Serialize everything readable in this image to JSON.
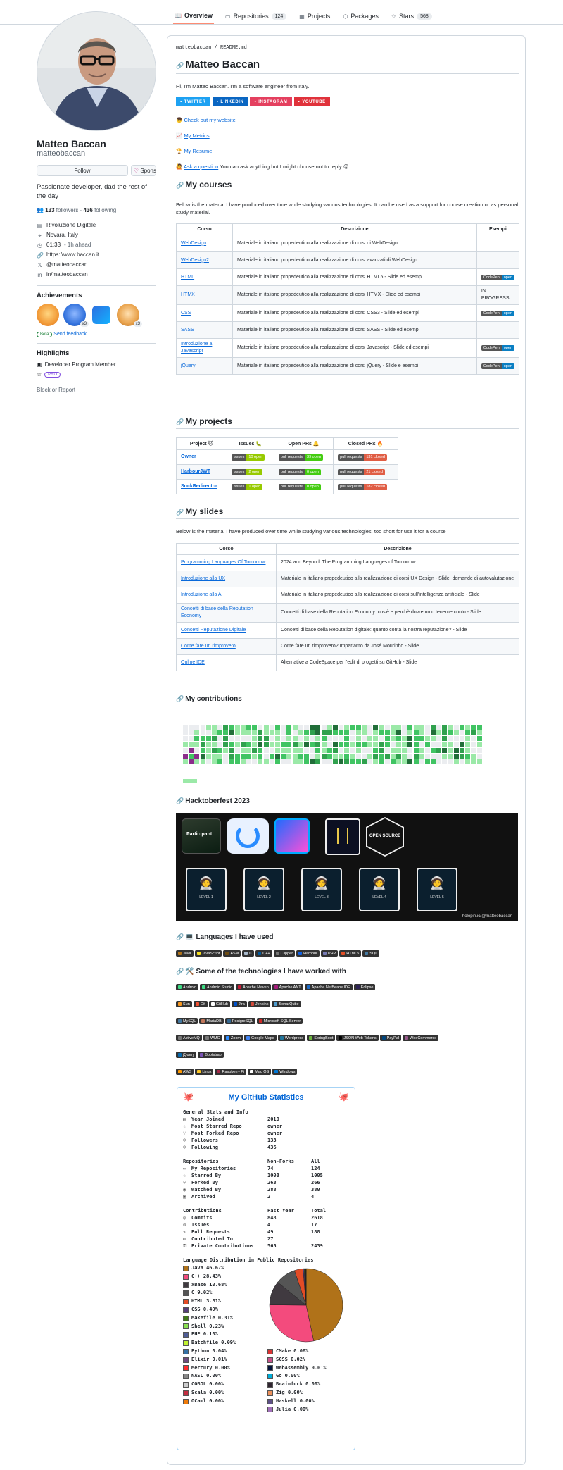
{
  "tabs": [
    {
      "label": "Overview",
      "icon": "book-icon",
      "count": ""
    },
    {
      "label": "Repositories",
      "icon": "repo-icon",
      "count": "124"
    },
    {
      "label": "Projects",
      "icon": "table-icon",
      "count": ""
    },
    {
      "label": "Packages",
      "icon": "package-icon",
      "count": ""
    },
    {
      "label": "Stars",
      "icon": "star-icon",
      "count": "568"
    }
  ],
  "profile": {
    "fullname": "Matteo Baccan",
    "username": "matteobaccan",
    "follow_label": "Follow",
    "sponsor_label": "Sponsor",
    "bio": "Passionate developer, dad the rest of the day",
    "followers": "133",
    "followers_label": "followers",
    "following": "436",
    "following_label": "following",
    "vcard": [
      {
        "icon": "organization-icon",
        "text": "Rivoluzione Digitale"
      },
      {
        "icon": "location-icon",
        "text": "Novara, Italy"
      },
      {
        "icon": "clock-icon",
        "text": "01:33",
        "sub": "- 1h ahead"
      },
      {
        "icon": "link-icon",
        "text": "https://www.baccan.it"
      },
      {
        "icon": "twitter-icon",
        "text": "@matteobaccan"
      },
      {
        "icon": "linkedin-icon",
        "text": "in/matteobaccan"
      }
    ],
    "achievements_title": "Achievements",
    "beta": "Beta",
    "send_feedback": "Send feedback",
    "highlights_title": "Highlights",
    "highlight_item": "Developer Program Member",
    "pro": "PRO",
    "block": "Block or Report"
  },
  "readme": {
    "path_user": "matteobaccan",
    "path_sep": "/",
    "path_file": "README.md",
    "title": "Matteo Baccan",
    "intro": "Hi, I'm Matteo Baccan. I'm a software engineer from Italy.",
    "social": [
      {
        "label": "TWITTER",
        "color": "#1da1f2"
      },
      {
        "label": "LINKEDIN",
        "color": "#0a66c2"
      },
      {
        "label": "INSTAGRAM",
        "color": "#e4405f"
      },
      {
        "label": "YOUTUBE",
        "color": "#e0323b"
      }
    ],
    "links": [
      {
        "emoji": "👦",
        "text": "Check out my website",
        "after": ""
      },
      {
        "emoji": "📈",
        "text": "My Metrics",
        "after": ""
      },
      {
        "emoji": "🏆",
        "text": "My Resume",
        "after": ""
      },
      {
        "emoji": "🙋",
        "text": "Ask a question",
        "after": " You can ask anything but I might choose not to reply 😜"
      }
    ],
    "courses_title": "My courses",
    "courses_intro": "Below is the material I have produced over time while studying various technologies. It can be used as a support for course creation or as personal study material.",
    "courses_headers": [
      "Corso",
      "Descrizione",
      "Esempi"
    ],
    "courses": [
      {
        "name": "WebDesign",
        "desc": "Materiale in italiano propedeutico alla realizzazione di corsi di WebDesign",
        "ex": ""
      },
      {
        "name": "WebDesign2",
        "desc": "Materiale in italiano propedeutico alla realizzazione di corsi avanzati di WebDesign",
        "ex": ""
      },
      {
        "name": "HTML",
        "desc": "Materiale in italiano propedeutico alla realizzazione di corsi HTML5 - Slide ed esempi",
        "ex": "codepen"
      },
      {
        "name": "HTMX",
        "desc": "Materiale in italiano propedeutico alla realizzazione di corsi HTMX - Slide ed esempi",
        "ex": "IN PROGRESS"
      },
      {
        "name": "CSS",
        "desc": "Materiale in italiano propedeutico alla realizzazione di corsi CSS3 - Slide ed esempi",
        "ex": "codepen"
      },
      {
        "name": "SASS",
        "desc": "Materiale in italiano propedeutico alla realizzazione di corsi SASS - Slide ed esempi",
        "ex": ""
      },
      {
        "name": "Introduzione a Javascript",
        "desc": "Materiale in italiano propedeutico alla realizzazione di corsi Javascript - Slide ed esempi",
        "ex": "codepen"
      },
      {
        "name": "jQuery",
        "desc": "Materiale in italiano propedeutico alla realizzazione di corsi jQuery - Slide e esempi",
        "ex": "codepen"
      }
    ],
    "codepen_left": "CodePen",
    "codepen_right": "open",
    "projects_title": "My projects",
    "projects_headers": [
      "Project 🐱",
      "Issues 🐛",
      "Open PRs 🔔",
      "Closed PRs 🔥"
    ],
    "projects": [
      {
        "name": "Owner",
        "issues": "10 open",
        "issues_color": "#97ca00",
        "open": "39 open",
        "open_color": "#4c1",
        "closed": "131 closed",
        "closed_color": "#e05d44"
      },
      {
        "name": "HarbourJWT",
        "issues": "2 open",
        "issues_color": "#97ca00",
        "open": "0 open",
        "open_color": "#4c1",
        "closed": "21 closed",
        "closed_color": "#e05d44"
      },
      {
        "name": "SockRedirector",
        "issues": "1 open",
        "issues_color": "#97ca00",
        "open": "0 open",
        "open_color": "#4c1",
        "closed": "182 closed",
        "closed_color": "#e05d44"
      }
    ],
    "issues_label": "issues",
    "pr_label": "pull requests",
    "slides_title": "My slides",
    "slides_intro": "Below is the material I have produced over time while studying various technologies, too short for use it for a course",
    "slides_headers": [
      "Corso",
      "Descrizione"
    ],
    "slides": [
      {
        "name": "Programming Languages Of Tomorrow",
        "desc": "2024 and Beyond: The Programming Languages of Tomorrow"
      },
      {
        "name": "Introduzione alla UX",
        "desc": "Materiale in italiano propedeutico alla realizzazione di corsi UX Design - Slide, domande di autovalutazione"
      },
      {
        "name": "Introduzione alla AI",
        "desc": "Materiale in italiano propedeutico alla realizzazione di corsi sull'intelligenza artificiale - Slide"
      },
      {
        "name": "Concetti di base della Reputation Economy",
        "desc": "Concetti di base della Reputation Economy: cos'è e perchè dovremmo tenerne conto - Slide"
      },
      {
        "name": "Concetti Reputazione Digitale",
        "desc": "Concetti di base della Reputation digitale: quanto conta la nostra reputazione? - Slide"
      },
      {
        "name": "Come fare un rimprovero",
        "desc": "Come fare un rimprovero? Impariamo da José Mourinho - Slide"
      },
      {
        "name": "Online IDE",
        "desc": "Alternative a CodeSpace per l'edit di progetti su GitHub - Slide"
      }
    ],
    "contrib_title": "My contributions",
    "hack_title": "Hacktoberfest 2023",
    "hack_participant": "Participant",
    "hack_badge_os": "OPEN SOURCE",
    "hack_credit": "holopin.io/@matteobaccan",
    "levels": [
      "LEVEL 1",
      "LEVEL 2",
      "LEVEL 3",
      "LEVEL 4",
      "LEVEL 5"
    ],
    "lang_title": "💻 Languages I have used",
    "languages": [
      {
        "label": "Java",
        "color": "#b07219"
      },
      {
        "label": "JavaScript",
        "color": "#f7df1e"
      },
      {
        "label": "ASM",
        "color": "#6e4c13"
      },
      {
        "label": "C",
        "color": "#a8b9cc"
      },
      {
        "label": "C++",
        "color": "#00599c"
      },
      {
        "label": "Clipper",
        "color": "#777"
      },
      {
        "label": "Harbour",
        "color": "#0e60e3"
      },
      {
        "label": "PHP",
        "color": "#777bb4"
      },
      {
        "label": "HTML5",
        "color": "#e34f26"
      },
      {
        "label": "SQL",
        "color": "#4479a1"
      }
    ],
    "tech_title": "🛠️ Some of the technologies I have worked with",
    "tech_rows": [
      [
        {
          "label": "Android",
          "color": "#3ddc84"
        },
        {
          "label": "Android Studio",
          "color": "#3ddc84"
        },
        {
          "label": "Apache Maven",
          "color": "#c71a36"
        },
        {
          "label": "Apache ANT",
          "color": "#a81c7d"
        },
        {
          "label": "Apache NetBeans IDE",
          "color": "#1b6ac6"
        },
        {
          "label": "Eclipse",
          "color": "#2c2255"
        }
      ],
      [
        {
          "label": "Sun",
          "color": "#f89820"
        },
        {
          "label": "Git",
          "color": "#f05032"
        },
        {
          "label": "GitHub",
          "color": "#fff"
        },
        {
          "label": "Jira",
          "color": "#0052cc"
        },
        {
          "label": "Jenkins",
          "color": "#d24939"
        },
        {
          "label": "SonarQube",
          "color": "#4e9bcd"
        }
      ],
      [
        {
          "label": "MySQL",
          "color": "#4479a1"
        },
        {
          "label": "MariaDB",
          "color": "#c0765a"
        },
        {
          "label": "PostgreSQL",
          "color": "#336791"
        },
        {
          "label": "Microsoft SQL Server",
          "color": "#cc2927"
        }
      ],
      [
        {
          "label": "ActiveMQ",
          "color": "#777"
        },
        {
          "label": "WMO",
          "color": "#777"
        },
        {
          "label": "Zoom",
          "color": "#2d8cff"
        },
        {
          "label": "Google Maps",
          "color": "#4285f4"
        },
        {
          "label": "Wordpress",
          "color": "#21759b"
        },
        {
          "label": "SpringBoot",
          "color": "#6db33f"
        },
        {
          "label": "JSON Web Tokens",
          "color": "#000"
        },
        {
          "label": "PayPal",
          "color": "#00457c"
        },
        {
          "label": "WooCommerce",
          "color": "#96588a"
        }
      ],
      [
        {
          "label": "jQuery",
          "color": "#0769ad"
        },
        {
          "label": "Bootstrap",
          "color": "#7952b3"
        }
      ],
      [
        {
          "label": "AWS",
          "color": "#ff9900"
        },
        {
          "label": "Linux",
          "color": "#fcc624"
        },
        {
          "label": "Raspberry Pi",
          "color": "#a22846"
        },
        {
          "label": "Mac OS",
          "color": "#fff"
        },
        {
          "label": "Windows",
          "color": "#0078d6"
        }
      ]
    ],
    "stats": {
      "title": "My GitHub Statistics",
      "general_title": "General Stats and Info",
      "general": [
        {
          "icon": "calendar-icon",
          "label": "Year Joined",
          "value": "2010"
        },
        {
          "icon": "star-icon",
          "label": "Most Starred Repo",
          "value": "owner"
        },
        {
          "icon": "fork-icon",
          "label": "Most Forked Repo",
          "value": "owner"
        },
        {
          "icon": "person-icon",
          "label": "Followers",
          "value": "133"
        },
        {
          "icon": "person-icon",
          "label": "Following",
          "value": "436"
        }
      ],
      "repo_headers": [
        "Repositories",
        "Non-Forks",
        "All"
      ],
      "repos": [
        {
          "icon": "repo-icon",
          "label": "My Repositories",
          "a": "74",
          "b": "124"
        },
        {
          "icon": "star-icon",
          "label": "Starred By",
          "a": "1003",
          "b": "1005"
        },
        {
          "icon": "fork-icon",
          "label": "Forked By",
          "a": "263",
          "b": "266"
        },
        {
          "icon": "eye-icon",
          "label": "Watched By",
          "a": "288",
          "b": "380"
        },
        {
          "icon": "archive-icon",
          "label": "Archived",
          "a": "2",
          "b": "4"
        }
      ],
      "contrib_headers": [
        "Contributions",
        "Past Year",
        "Total"
      ],
      "contribs": [
        {
          "icon": "commit-icon",
          "label": "Commits",
          "a": "848",
          "b": "2618"
        },
        {
          "icon": "issue-icon",
          "label": "Issues",
          "a": "4",
          "b": "17"
        },
        {
          "icon": "pr-icon",
          "label": "Pull Requests",
          "a": "49",
          "b": "188"
        },
        {
          "icon": "repo-icon",
          "label": "Contributed To",
          "a": "27",
          "b": ""
        },
        {
          "icon": "lock-icon",
          "label": "Private Contributions",
          "a": "565",
          "b": "2439"
        }
      ],
      "lang_title": "Language Distribution in Public Repositories",
      "langs_left": [
        {
          "label": "Java 46.67%",
          "color": "#b07219"
        },
        {
          "label": "C++ 28.43%",
          "color": "#f34b7d"
        },
        {
          "label": "xBase 10.68%",
          "color": "#403a40"
        },
        {
          "label": "C 9.02%",
          "color": "#555555"
        },
        {
          "label": "HTML 3.81%",
          "color": "#e34c26"
        },
        {
          "label": "CSS 0.49%",
          "color": "#563d7c"
        },
        {
          "label": "Makefile 0.31%",
          "color": "#427819"
        },
        {
          "label": "Shell 0.23%",
          "color": "#89e051"
        },
        {
          "label": "PHP 0.10%",
          "color": "#4f5d95"
        },
        {
          "label": "Batchfile 0.09%",
          "color": "#c1f12e"
        },
        {
          "label": "Python 0.04%",
          "color": "#3572a5"
        },
        {
          "label": "Elixir 0.01%",
          "color": "#6e4a7e"
        },
        {
          "label": "Mercury 0.00%",
          "color": "#ff2b2b"
        },
        {
          "label": "NASL 0.00%",
          "color": "#888888"
        },
        {
          "label": "COBOL 0.00%",
          "color": "#cccccc"
        },
        {
          "label": "Scala 0.00%",
          "color": "#c22d40"
        },
        {
          "label": "OCaml 0.00%",
          "color": "#ef7a08"
        }
      ],
      "langs_right": [
        {
          "label": "CMake 0.06%",
          "color": "#da3434"
        },
        {
          "label": "SCSS 0.02%",
          "color": "#c6538c"
        },
        {
          "label": "WebAssembly 0.01%",
          "color": "#04133b"
        },
        {
          "label": "Go 0.00%",
          "color": "#00add8"
        },
        {
          "label": "Brainfuck 0.00%",
          "color": "#2f2530"
        },
        {
          "label": "Zig 0.00%",
          "color": "#ec915c"
        },
        {
          "label": "Haskell 0.00%",
          "color": "#5e5086"
        },
        {
          "label": "Julia 0.00%",
          "color": "#a270ba"
        }
      ],
      "pie": [
        46.67,
        28.43,
        10.68,
        9.02,
        3.81,
        0.49,
        0.31,
        0.23,
        0.1,
        0.09,
        0.04,
        0.01,
        0.06,
        0.02,
        0.01
      ]
    }
  }
}
